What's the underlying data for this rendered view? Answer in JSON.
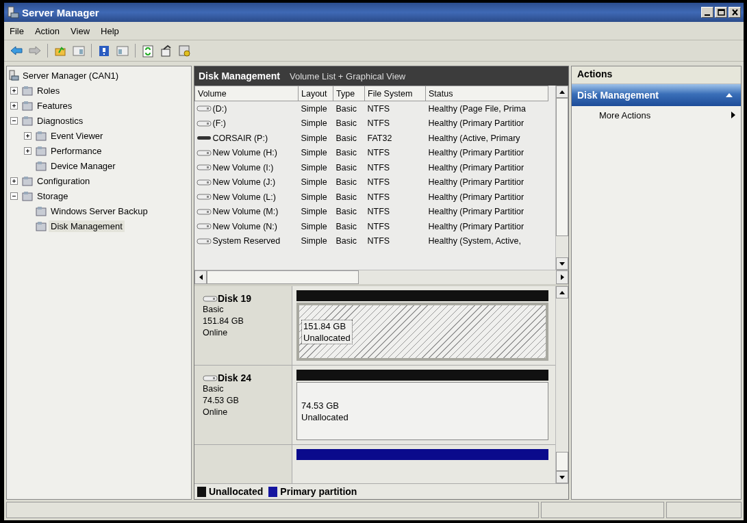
{
  "window": {
    "title": "Server Manager"
  },
  "menu": [
    "File",
    "Action",
    "View",
    "Help"
  ],
  "tree": {
    "label": "Server Manager (CAN1)",
    "children": [
      {
        "label": "Roles",
        "kind": "collapsed",
        "selected": false
      },
      {
        "label": "Features",
        "kind": "collapsed",
        "selected": false
      },
      {
        "label": "Diagnostics",
        "kind": "expanded",
        "selected": false,
        "children": [
          {
            "label": "Event Viewer",
            "kind": "collapsed",
            "selected": false
          },
          {
            "label": "Performance",
            "kind": "collapsed",
            "selected": false
          },
          {
            "label": "Device Manager",
            "kind": "leaf",
            "selected": false
          }
        ]
      },
      {
        "label": "Configuration",
        "kind": "collapsed",
        "selected": false
      },
      {
        "label": "Storage",
        "kind": "expanded",
        "selected": false,
        "children": [
          {
            "label": "Windows Server Backup",
            "kind": "leaf",
            "selected": false
          },
          {
            "label": "Disk Management",
            "kind": "leaf",
            "selected": true
          }
        ]
      }
    ]
  },
  "center": {
    "title": "Disk Management",
    "subtitle": "Volume List + Graphical View"
  },
  "volumes": {
    "columns": [
      "Volume",
      "Layout",
      "Type",
      "File System",
      "Status"
    ],
    "rows": [
      {
        "kind": "disk",
        "cells": [
          "(D:)",
          "Simple",
          "Basic",
          "NTFS",
          "Healthy (Page File, Prima"
        ]
      },
      {
        "kind": "disk",
        "cells": [
          "(F:)",
          "Simple",
          "Basic",
          "NTFS",
          "Healthy (Primary Partitior"
        ]
      },
      {
        "kind": "removable",
        "cells": [
          "CORSAIR (P:)",
          "Simple",
          "Basic",
          "FAT32",
          "Healthy (Active, Primary"
        ]
      },
      {
        "kind": "disk",
        "cells": [
          "New Volume (H:)",
          "Simple",
          "Basic",
          "NTFS",
          "Healthy (Primary Partitior"
        ]
      },
      {
        "kind": "disk",
        "cells": [
          "New Volume (I:)",
          "Simple",
          "Basic",
          "NTFS",
          "Healthy (Primary Partitior"
        ]
      },
      {
        "kind": "disk",
        "cells": [
          "New Volume (J:)",
          "Simple",
          "Basic",
          "NTFS",
          "Healthy (Primary Partitior"
        ]
      },
      {
        "kind": "disk",
        "cells": [
          "New Volume (L:)",
          "Simple",
          "Basic",
          "NTFS",
          "Healthy (Primary Partitior"
        ]
      },
      {
        "kind": "disk",
        "cells": [
          "New Volume (M:)",
          "Simple",
          "Basic",
          "NTFS",
          "Healthy (Primary Partitior"
        ]
      },
      {
        "kind": "disk",
        "cells": [
          "New Volume (N:)",
          "Simple",
          "Basic",
          "NTFS",
          "Healthy (Primary Partitior"
        ]
      },
      {
        "kind": "disk",
        "cells": [
          "System Reserved",
          "Simple",
          "Basic",
          "NTFS",
          "Healthy (System, Active,"
        ]
      }
    ]
  },
  "disks": [
    {
      "name": "Disk 19",
      "type": "Basic",
      "size": "151.84 GB",
      "status": "Online",
      "partitions": [
        {
          "size": "151.84 GB",
          "label": "Unallocated",
          "color": "#111111",
          "selected": true
        }
      ]
    },
    {
      "name": "Disk 24",
      "type": "Basic",
      "size": "74.53 GB",
      "status": "Online",
      "partitions": [
        {
          "size": "74.53 GB",
          "label": "Unallocated",
          "color": "#111111",
          "selected": false
        }
      ]
    },
    {
      "partitions": [
        {
          "color": "#0a0a8c"
        }
      ]
    }
  ],
  "legend": [
    {
      "label": "Unallocated",
      "color": "#111111"
    },
    {
      "label": "Primary partition",
      "color": "#1515a0"
    }
  ],
  "actions": {
    "title": "Actions",
    "section": {
      "title": "Disk Management",
      "expanded": true
    },
    "items": [
      "More Actions"
    ]
  }
}
